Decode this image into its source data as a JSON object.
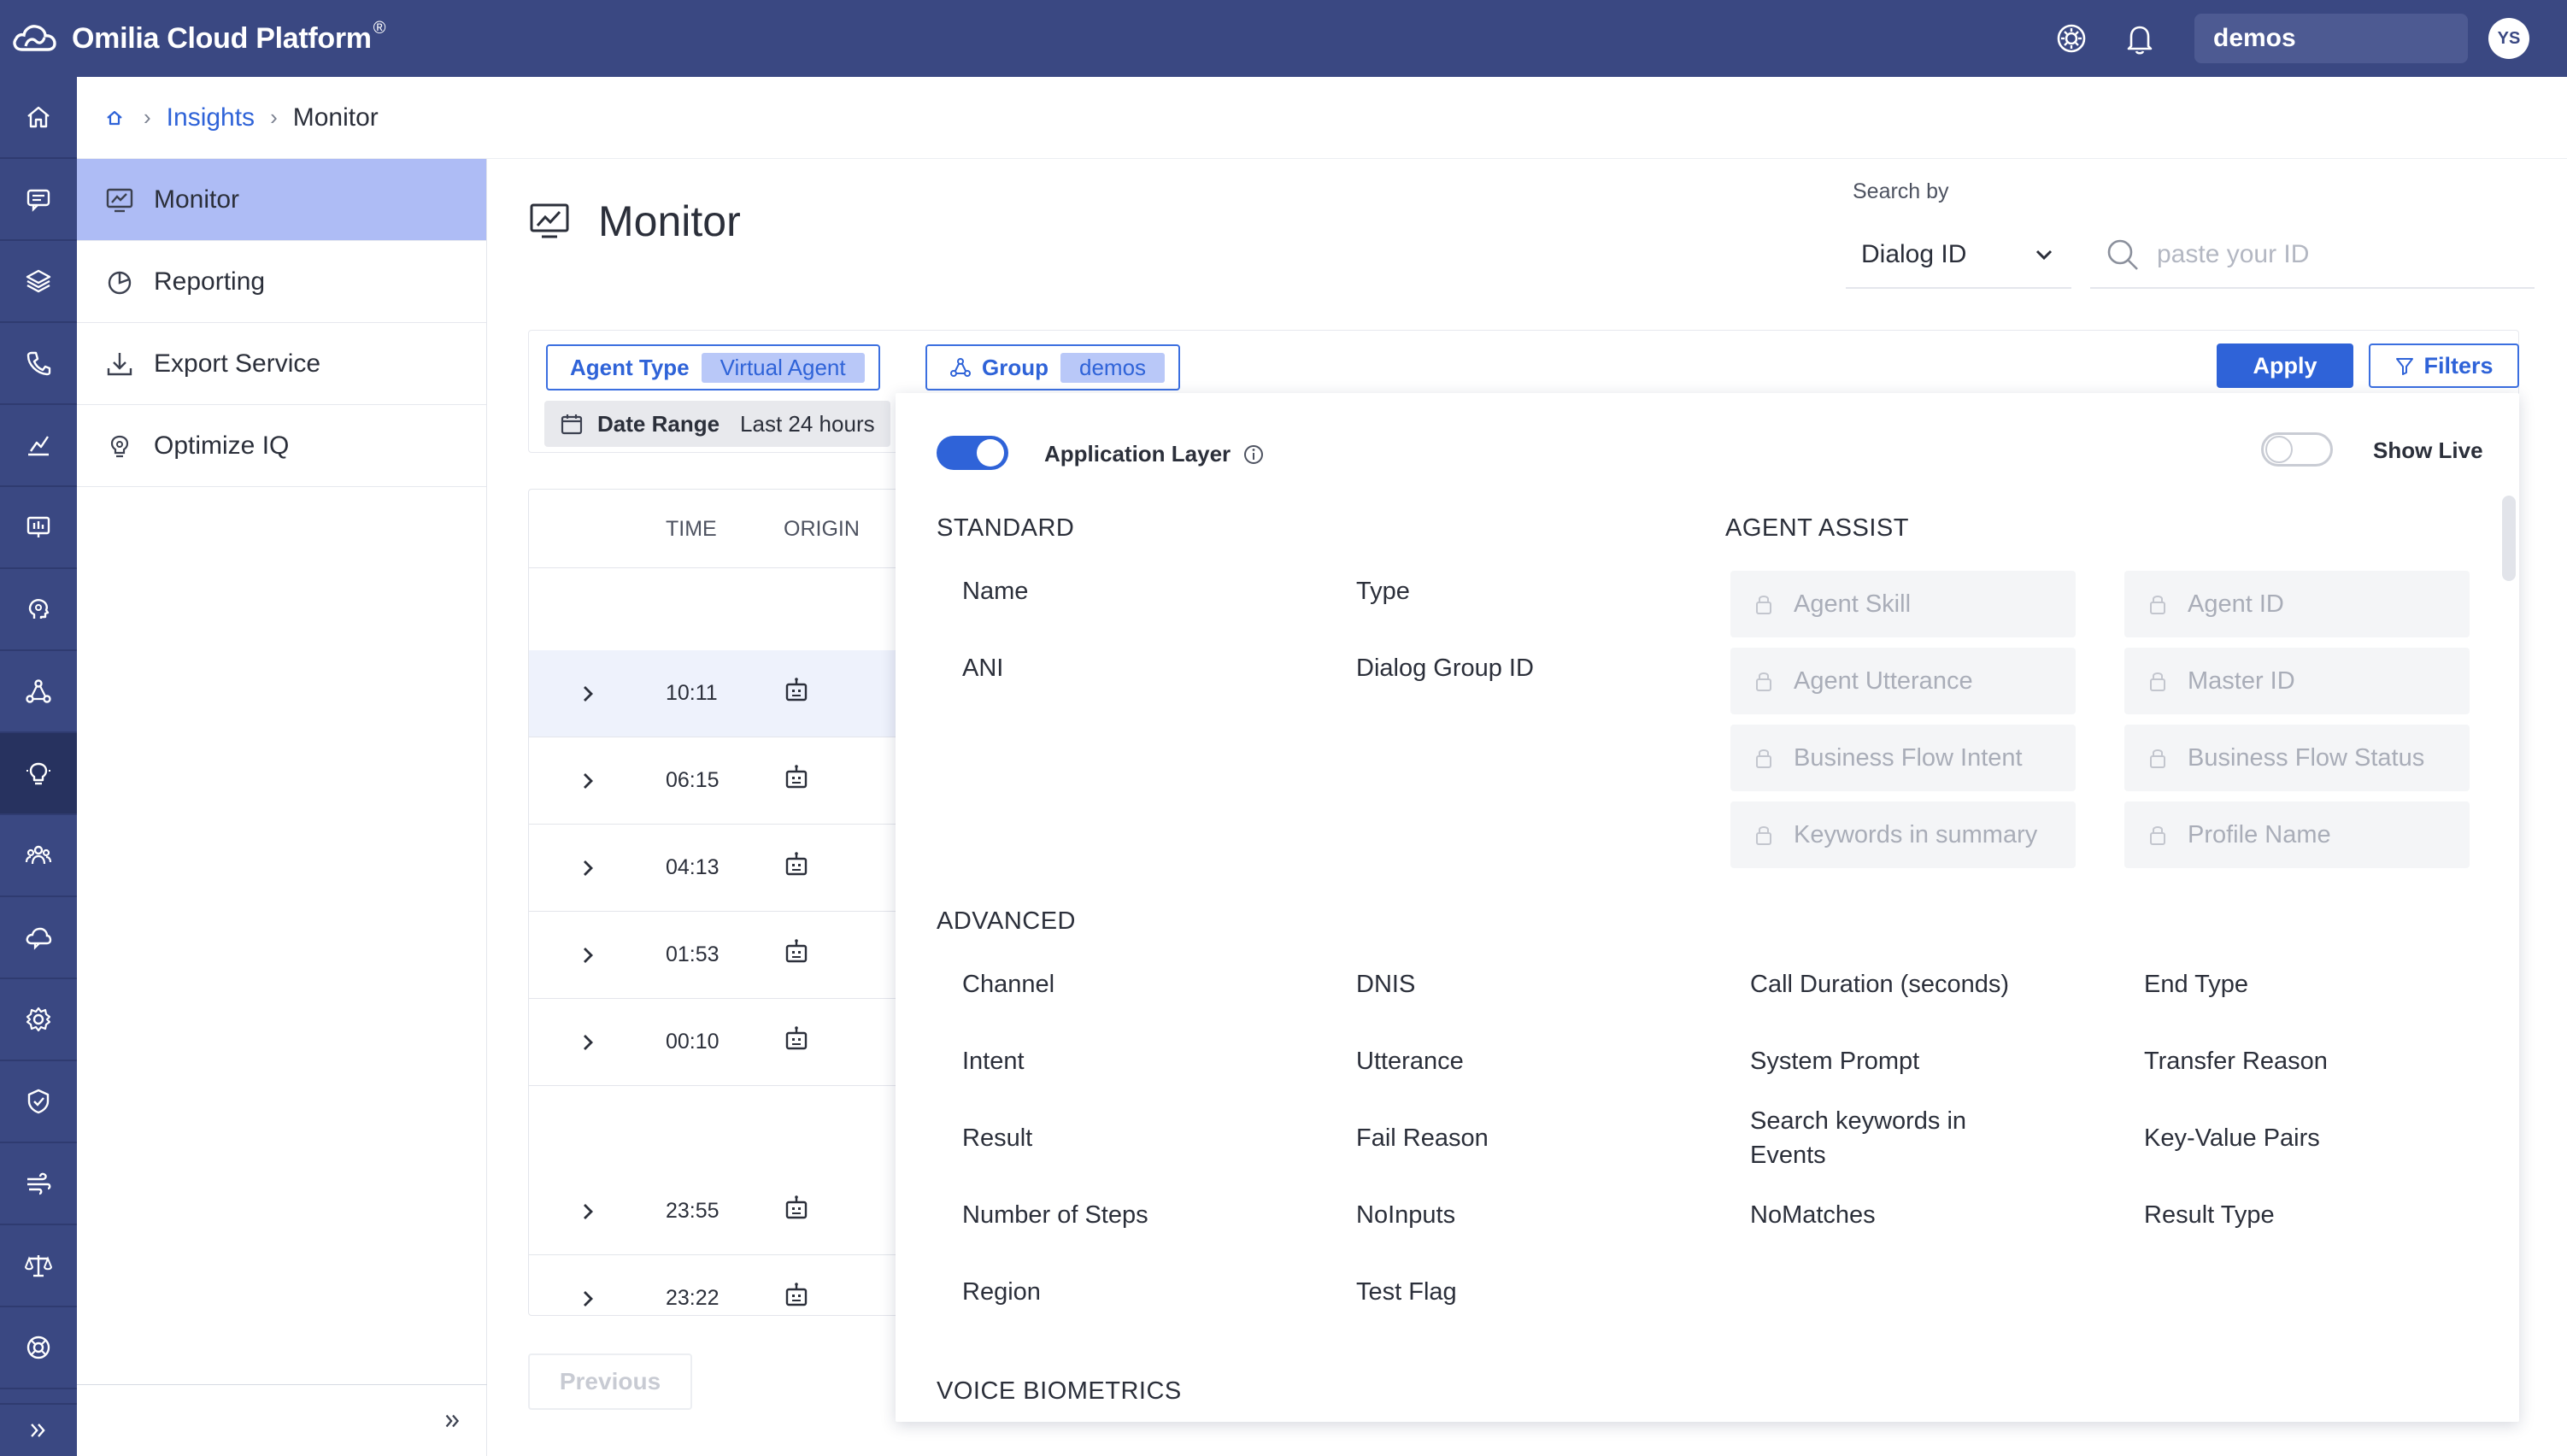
{
  "app": {
    "title": "Omilia Cloud Platform",
    "title_mark": "®",
    "org": "demos",
    "user_initials": "YS",
    "brand_color": "#3a4882",
    "accent_color": "#2f63d8"
  },
  "rail": {
    "icons": [
      "home-icon",
      "chat-bot-icon",
      "layers-icon",
      "phone-flow-icon",
      "analytics-icon",
      "presentation-icon",
      "brain-icon",
      "network-icon",
      "lightbulb-icon",
      "group-icon",
      "cloud-chat-icon",
      "settings-cog-icon",
      "shield-check-icon",
      "wind-icon",
      "balance-icon",
      "support-icon"
    ],
    "active_index": 8
  },
  "breadcrumb": {
    "home_icon": "home-icon",
    "items": [
      "Insights",
      "Monitor"
    ]
  },
  "subnav": {
    "items": [
      {
        "label": "Monitor",
        "icon": "monitor-chart-icon"
      },
      {
        "label": "Reporting",
        "icon": "pie-chart-icon"
      },
      {
        "label": "Export Service",
        "icon": "download-icon"
      },
      {
        "label": "Optimize IQ",
        "icon": "lightbulb-icon"
      }
    ],
    "active_index": 0
  },
  "page": {
    "title": "Monitor",
    "search_by_label": "Search by",
    "search_type": "Dialog ID",
    "search_placeholder": "paste your ID"
  },
  "filterbar": {
    "agent_type_label": "Agent Type",
    "agent_type_value": "Virtual Agent",
    "group_label": "Group",
    "group_value": "demos",
    "date_range_label": "Date Range",
    "date_range_value": "Last 24 hours",
    "apply_label": "Apply",
    "filters_label": "Filters"
  },
  "table": {
    "columns": [
      "TIME",
      "ORIGIN"
    ],
    "rows": [
      {
        "time": "10:11"
      },
      {
        "time": "06:15"
      },
      {
        "time": "04:13"
      },
      {
        "time": "01:53"
      },
      {
        "time": "00:10"
      },
      {
        "time": "23:55"
      },
      {
        "time": "23:22"
      }
    ],
    "previous_label": "Previous"
  },
  "panel": {
    "application_layer_label": "Application Layer",
    "application_layer_on": true,
    "show_live_label": "Show Live",
    "show_live_on": false,
    "standard": {
      "title": "STANDARD",
      "options": [
        "Name",
        "Type",
        "ANI",
        "Dialog Group ID"
      ]
    },
    "agent_assist": {
      "title": "AGENT ASSIST",
      "options": [
        "Agent Skill",
        "Agent ID",
        "Agent Utterance",
        "Master ID",
        "Business Flow Intent",
        "Business Flow Status",
        "Keywords in summary",
        "Profile Name"
      ]
    },
    "advanced": {
      "title": "ADVANCED",
      "options": [
        "Channel",
        "DNIS",
        "Call Duration (seconds)",
        "End Type",
        "Intent",
        "Utterance",
        "System Prompt",
        "Transfer Reason",
        "Result",
        "Fail Reason",
        "Search keywords in Events",
        "Key-Value Pairs",
        "Number of Steps",
        "NoInputs",
        "NoMatches",
        "Result Type",
        "Region",
        "Test Flag"
      ]
    },
    "voice_biometrics": {
      "title": "VOICE BIOMETRICS"
    }
  }
}
